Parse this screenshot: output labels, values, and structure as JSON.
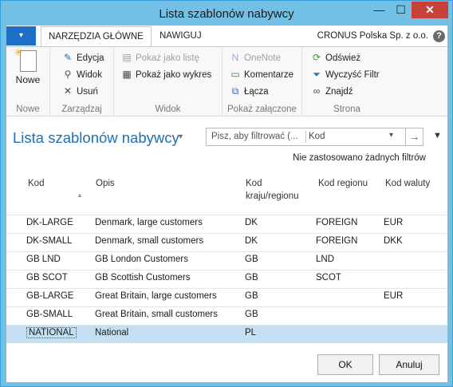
{
  "window": {
    "title": "Lista szablonów nabywcy",
    "minimize": "—",
    "maximize": "☐",
    "close": "✕"
  },
  "ribbon_tabs": {
    "file": "▾",
    "home": "NARZĘDZIA GŁÓWNE",
    "navigate": "NAWIGUJ"
  },
  "company": "CRONUS Polska Sp. z o.o.",
  "help": "?",
  "groups": {
    "new": {
      "label": "Nowe",
      "new_btn": "Nowe"
    },
    "manage": {
      "label": "Zarządzaj",
      "edit": "Edycja",
      "view": "Widok",
      "delete": "Usuń"
    },
    "view": {
      "label": "Widok",
      "show_list": "Pokaż jako listę",
      "show_chart": "Pokaż jako wykres"
    },
    "attachments": {
      "label": "Pokaż załączone",
      "onenote": "OneNote",
      "comments": "Komentarze",
      "links": "Łącza"
    },
    "page": {
      "label": "Strona",
      "refresh": "Odśwież",
      "clear_filter": "Wyczyść Filtr",
      "find": "Znajdź"
    }
  },
  "page_title": "Lista szablonów nabywcy",
  "search": {
    "placeholder": "Pisz, aby filtrować (...",
    "field": "Kod"
  },
  "filter_status": "Nie zastosowano żadnych filtrów",
  "columns": {
    "code": "Kod",
    "description": "Opis",
    "country1": "Kod",
    "country2": "kraju/regionu",
    "region": "Kod regionu",
    "currency": "Kod waluty"
  },
  "rows": [
    {
      "code": "DK-LARGE",
      "description": "Denmark, large customers",
      "country": "DK",
      "region": "FOREIGN",
      "currency": "EUR"
    },
    {
      "code": "DK-SMALL",
      "description": "Denmark, small customers",
      "country": "DK",
      "region": "FOREIGN",
      "currency": "DKK"
    },
    {
      "code": "GB LND",
      "description": "GB London Customers",
      "country": "GB",
      "region": "LND",
      "currency": ""
    },
    {
      "code": "GB SCOT",
      "description": "GB Scottish Customers",
      "country": "GB",
      "region": "SCOT",
      "currency": ""
    },
    {
      "code": "GB-LARGE",
      "description": "Great Britain, large customers",
      "country": "GB",
      "region": "",
      "currency": "EUR"
    },
    {
      "code": "GB-SMALL",
      "description": "Great Britain, small customers",
      "country": "GB",
      "region": "",
      "currency": ""
    },
    {
      "code": "NATIONAL",
      "description": "National",
      "country": "PL",
      "region": "",
      "currency": ""
    }
  ],
  "buttons": {
    "ok": "OK",
    "cancel": "Anuluj"
  }
}
